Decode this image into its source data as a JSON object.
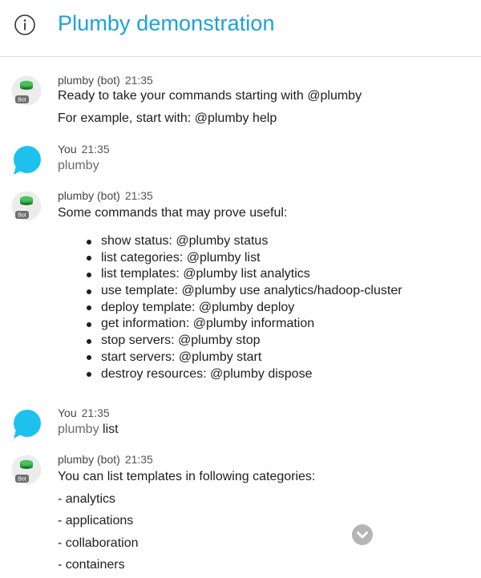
{
  "header": {
    "title": "Plumby demonstration",
    "icon": "info-icon"
  },
  "avatars": {
    "bot_badge": "Bot",
    "bot_color": "#2eaa45",
    "you_color": "#1ec1ee"
  },
  "messages": [
    {
      "sender": "plumby (bot)",
      "time": "21:35",
      "lines": [
        "Ready to take your commands starting with @plumby",
        "For example, start with: @plumby help"
      ]
    },
    {
      "sender": "You",
      "time": "21:35",
      "text": "plumby"
    },
    {
      "sender": "plumby (bot)",
      "time": "21:35",
      "intro": "Some commands that may prove useful:",
      "commands": [
        "show status: @plumby status",
        "list categories: @plumby list",
        "list templates: @plumby list analytics",
        "use template: @plumby use analytics/hadoop-cluster",
        "deploy template: @plumby deploy",
        "get information: @plumby information",
        "stop servers: @plumby stop",
        "start servers: @plumby start",
        "destroy resources: @plumby dispose"
      ]
    },
    {
      "sender": "You",
      "time": "21:35",
      "prefix": "plumby",
      "suffix": " list"
    },
    {
      "sender": "plumby (bot)",
      "time": "21:35",
      "lines": [
        "You can list templates in following categories:",
        "- analytics",
        "- applications",
        "- collaboration",
        "- containers"
      ]
    }
  ],
  "scroll_button": {
    "icon": "chevron-down-icon"
  }
}
